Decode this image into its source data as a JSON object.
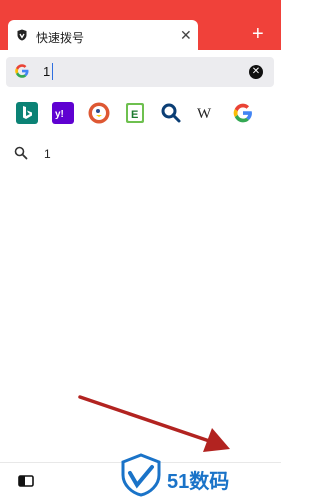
{
  "browser": {
    "tab_title": "快速拨号",
    "tab_close_symbol": "✕",
    "new_tab_symbol": "+",
    "url_value": "1",
    "clear_symbol": "✕",
    "colors": {
      "brand_red": "#f0413a",
      "url_bg": "#ececef"
    }
  },
  "engines": [
    {
      "name": "bing-icon",
      "color": "#0b8275"
    },
    {
      "name": "yahoo-icon",
      "color": "#5f01d1"
    },
    {
      "name": "duckduckgo-icon",
      "color": "#de5833"
    },
    {
      "name": "evernote-like-e-icon",
      "color": "#1b7a2f"
    },
    {
      "name": "search-engine-q-icon",
      "color": "#0b3e75"
    },
    {
      "name": "wikipedia-icon",
      "color": "#222222"
    },
    {
      "name": "google-icon",
      "color": "#4285f4"
    }
  ],
  "suggestion": {
    "text": "1"
  },
  "watermark": {
    "text": "51数码"
  }
}
